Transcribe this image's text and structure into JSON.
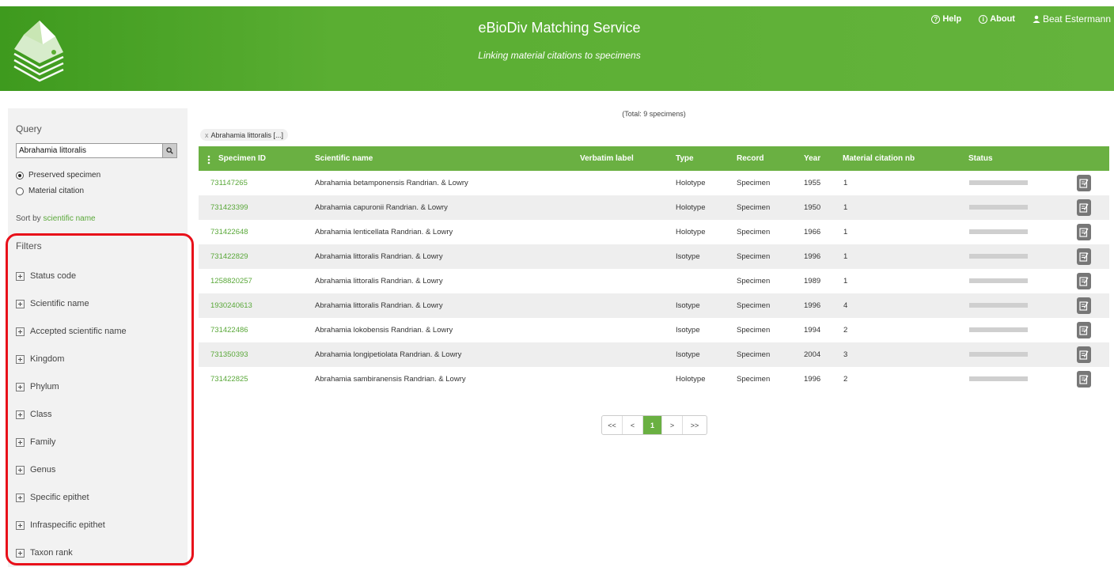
{
  "header": {
    "title": "eBioDiv Matching Service",
    "subtitle": "Linking material citations to specimens",
    "help_label": "Help",
    "about_label": "About",
    "user_name": "Beat Estermann",
    "color": "#5aae32"
  },
  "sidebar": {
    "query_label": "Query",
    "search_value": "Abrahamia littoralis",
    "radio_preserved": "Preserved specimen",
    "radio_citation": "Material citation",
    "sort_prefix": "Sort by",
    "sort_value": "scientific name",
    "filters_label": "Filters",
    "filters": [
      "Status code",
      "Scientific name",
      "Accepted scientific name",
      "Kingdom",
      "Phylum",
      "Class",
      "Family",
      "Genus",
      "Specific epithet",
      "Infraspecific epithet",
      "Taxon rank"
    ]
  },
  "main": {
    "total": "(Total: 9 specimens)",
    "chip_close": "x",
    "chip_label": "Abrahamia littoralis [...]",
    "columns": {
      "id": "Specimen ID",
      "name": "Scientific name",
      "verbatim": "Verbatim label",
      "type": "Type",
      "record": "Record",
      "year": "Year",
      "citation_nb": "Material citation nb",
      "status": "Status"
    },
    "rows": [
      {
        "id": "731147265",
        "name": "Abrahamia betamponensis Randrian. & Lowry",
        "verbatim": "",
        "type": "Holotype",
        "record": "Specimen",
        "year": "1955",
        "nb": "1"
      },
      {
        "id": "731423399",
        "name": "Abrahamia capuronii Randrian. & Lowry",
        "verbatim": "",
        "type": "Holotype",
        "record": "Specimen",
        "year": "1950",
        "nb": "1"
      },
      {
        "id": "731422648",
        "name": "Abrahamia lenticellata Randrian. & Lowry",
        "verbatim": "",
        "type": "Holotype",
        "record": "Specimen",
        "year": "1966",
        "nb": "1"
      },
      {
        "id": "731422829",
        "name": "Abrahamia littoralis Randrian. & Lowry",
        "verbatim": "",
        "type": "Isotype",
        "record": "Specimen",
        "year": "1996",
        "nb": "1"
      },
      {
        "id": "1258820257",
        "name": "Abrahamia littoralis Randrian. & Lowry",
        "verbatim": "",
        "type": "",
        "record": "Specimen",
        "year": "1989",
        "nb": "1"
      },
      {
        "id": "1930240613",
        "name": "Abrahamia littoralis Randrian. & Lowry",
        "verbatim": "",
        "type": "Isotype",
        "record": "Specimen",
        "year": "1996",
        "nb": "4"
      },
      {
        "id": "731422486",
        "name": "Abrahamia lokobensis Randrian. & Lowry",
        "verbatim": "",
        "type": "Isotype",
        "record": "Specimen",
        "year": "1994",
        "nb": "2"
      },
      {
        "id": "731350393",
        "name": "Abrahamia longipetiolata Randrian. & Lowry",
        "verbatim": "",
        "type": "Isotype",
        "record": "Specimen",
        "year": "2004",
        "nb": "3"
      },
      {
        "id": "731422825",
        "name": "Abrahamia sambiranensis Randrian. & Lowry",
        "verbatim": "",
        "type": "Holotype",
        "record": "Specimen",
        "year": "1996",
        "nb": "2"
      }
    ]
  },
  "pagination": {
    "first": "<<",
    "prev": "<",
    "current": "1",
    "next": ">",
    "last": ">>"
  }
}
